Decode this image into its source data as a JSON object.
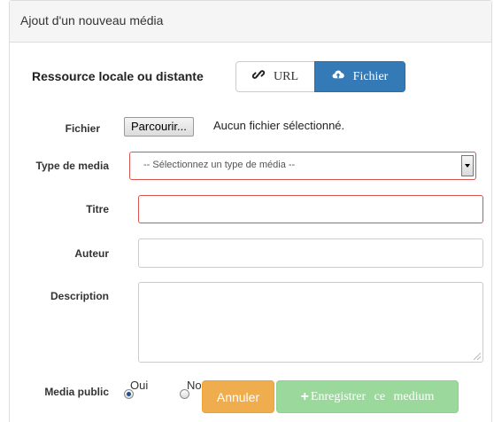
{
  "panel": {
    "title": "Ajout d'un nouveau média"
  },
  "source": {
    "label": "Ressource locale ou distante",
    "url_label": "URL",
    "file_label": "Fichier",
    "url_icon": "link-icon",
    "file_icon": "cloud-upload-icon",
    "active": "Fichier"
  },
  "fields": {
    "fichier_label": "Fichier",
    "browse_label": "Parcourir...",
    "no_file_text": "Aucun fichier sélectionné.",
    "type_label": "Type de media",
    "type_selected": "-- Sélectionnez un type de média --",
    "titre_label": "Titre",
    "titre_value": "",
    "auteur_label": "Auteur",
    "auteur_value": "",
    "description_label": "Description",
    "description_value": "",
    "public_label": "Media public",
    "public_yes": "Oui",
    "public_no": "Non",
    "public_selected": "Oui"
  },
  "actions": {
    "cancel_label": "Annuler",
    "save_label": "Enregistrer ce medium"
  },
  "colors": {
    "primary": "#337ab7",
    "warning": "#f0ad4e",
    "success_disabled": "#9bd89b",
    "error_border": "#d9534f"
  }
}
